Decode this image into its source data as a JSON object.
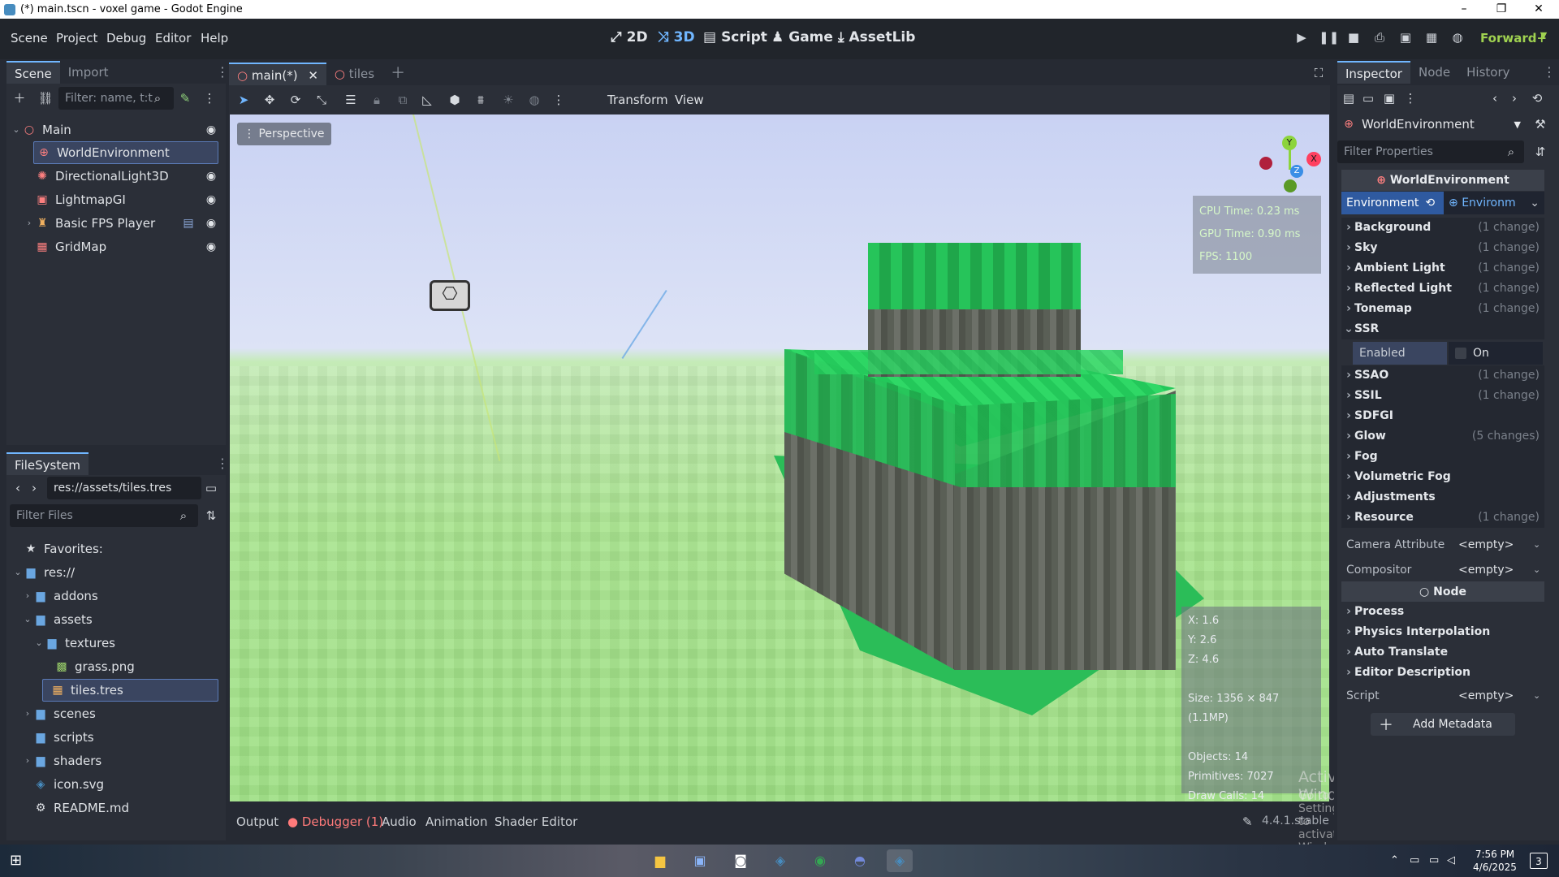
{
  "window": {
    "title": "(*) main.tscn - voxel game - Godot Engine",
    "min": "–",
    "max": "❐",
    "close": "✕"
  },
  "menu": {
    "items": [
      "Scene",
      "Project",
      "Debug",
      "Editor",
      "Help"
    ]
  },
  "workspaces": {
    "2d": "2D",
    "3d": "3D",
    "script": "Script",
    "game": "Game",
    "assetlib": "AssetLib"
  },
  "renderer": "Forward+",
  "scene_dock": {
    "tab_scene": "Scene",
    "tab_import": "Import",
    "filter_placeholder": "Filter: name, t:t",
    "nodes": [
      {
        "label": "Main",
        "icon": "node3d-icon"
      },
      {
        "label": "WorldEnvironment",
        "icon": "world-environment-icon"
      },
      {
        "label": "DirectionalLight3D",
        "icon": "directional-light-icon"
      },
      {
        "label": "LightmapGI",
        "icon": "lightmap-icon"
      },
      {
        "label": "Basic FPS Player",
        "icon": "player-icon"
      },
      {
        "label": "GridMap",
        "icon": "gridmap-icon"
      }
    ]
  },
  "filesystem": {
    "tab": "FileSystem",
    "path": "res://assets/tiles.tres",
    "filter_placeholder": "Filter Files",
    "items": [
      {
        "label": "Favorites:"
      },
      {
        "label": "res://"
      },
      {
        "label": "addons"
      },
      {
        "label": "assets"
      },
      {
        "label": "textures"
      },
      {
        "label": "grass.png"
      },
      {
        "label": "tiles.tres"
      },
      {
        "label": "scenes"
      },
      {
        "label": "scripts"
      },
      {
        "label": "shaders"
      },
      {
        "label": "icon.svg"
      },
      {
        "label": "README.md"
      }
    ]
  },
  "editor_tabs": [
    {
      "label": "main(*)"
    },
    {
      "label": "tiles"
    }
  ],
  "viewport": {
    "toolbar_transform": "Transform",
    "toolbar_view": "View",
    "perspective": "Perspective",
    "cpu": "CPU Time: 0.23 ms",
    "gpu": "GPU Time: 0.90 ms",
    "fps": "FPS: 1100",
    "x": "X: 1.6",
    "y": "Y: 2.6",
    "z": "Z: 4.6",
    "size": "Size: 1356 × 847 (1.1MP)",
    "objects": "Objects: 14",
    "primitives": "Primitives: 7027",
    "drawcalls": "Draw Calls: 14",
    "gizmo_y": "Y",
    "gizmo_x": "X",
    "gizmo_z": "Z",
    "watermark1": "Activate Windows",
    "watermark2": "Go to Settings to activate Windows."
  },
  "bottom_panel": {
    "output": "Output",
    "debugger": "Debugger (1)",
    "audio": "Audio",
    "animation": "Animation",
    "shader": "Shader Editor",
    "version": "4.4.1.stable"
  },
  "inspector": {
    "tab_inspector": "Inspector",
    "tab_node": "Node",
    "tab_history": "History",
    "object": "WorldEnvironment",
    "filter_placeholder": "Filter Properties",
    "header": "WorldEnvironment",
    "env_label": "Environment",
    "env_value": "Environm",
    "categories": [
      {
        "name": "Background",
        "changes": "(1 change)"
      },
      {
        "name": "Sky",
        "changes": "(1 change)"
      },
      {
        "name": "Ambient Light",
        "changes": "(1 change)"
      },
      {
        "name": "Reflected Light",
        "changes": "(1 change)"
      },
      {
        "name": "Tonemap",
        "changes": "(1 change)"
      },
      {
        "name": "SSR",
        "changes": ""
      }
    ],
    "ssr_enabled_label": "Enabled",
    "ssr_enabled_value": "On",
    "categories2": [
      {
        "name": "SSAO",
        "changes": "(1 change)"
      },
      {
        "name": "SSIL",
        "changes": "(1 change)"
      },
      {
        "name": "SDFGI",
        "changes": ""
      },
      {
        "name": "Glow",
        "changes": "(5 changes)"
      },
      {
        "name": "Fog",
        "changes": ""
      },
      {
        "name": "Volumetric Fog",
        "changes": ""
      },
      {
        "name": "Adjustments",
        "changes": ""
      },
      {
        "name": "Resource",
        "changes": "(1 change)"
      }
    ],
    "camera_attr_label": "Camera Attribute",
    "camera_attr_value": "<empty>",
    "compositor_label": "Compositor",
    "compositor_value": "<empty>",
    "node_header": "Node",
    "node_cats": [
      "Process",
      "Physics Interpolation",
      "Auto Translate",
      "Editor Description"
    ],
    "script_label": "Script",
    "script_value": "<empty>",
    "add_metadata": "Add Metadata"
  },
  "taskbar": {
    "time": "7:56 PM",
    "date": "4/6/2025",
    "notif": "3"
  },
  "colors": {
    "accent": "#70b6ff",
    "renderer": "#9fd150",
    "background": "#262a33"
  }
}
